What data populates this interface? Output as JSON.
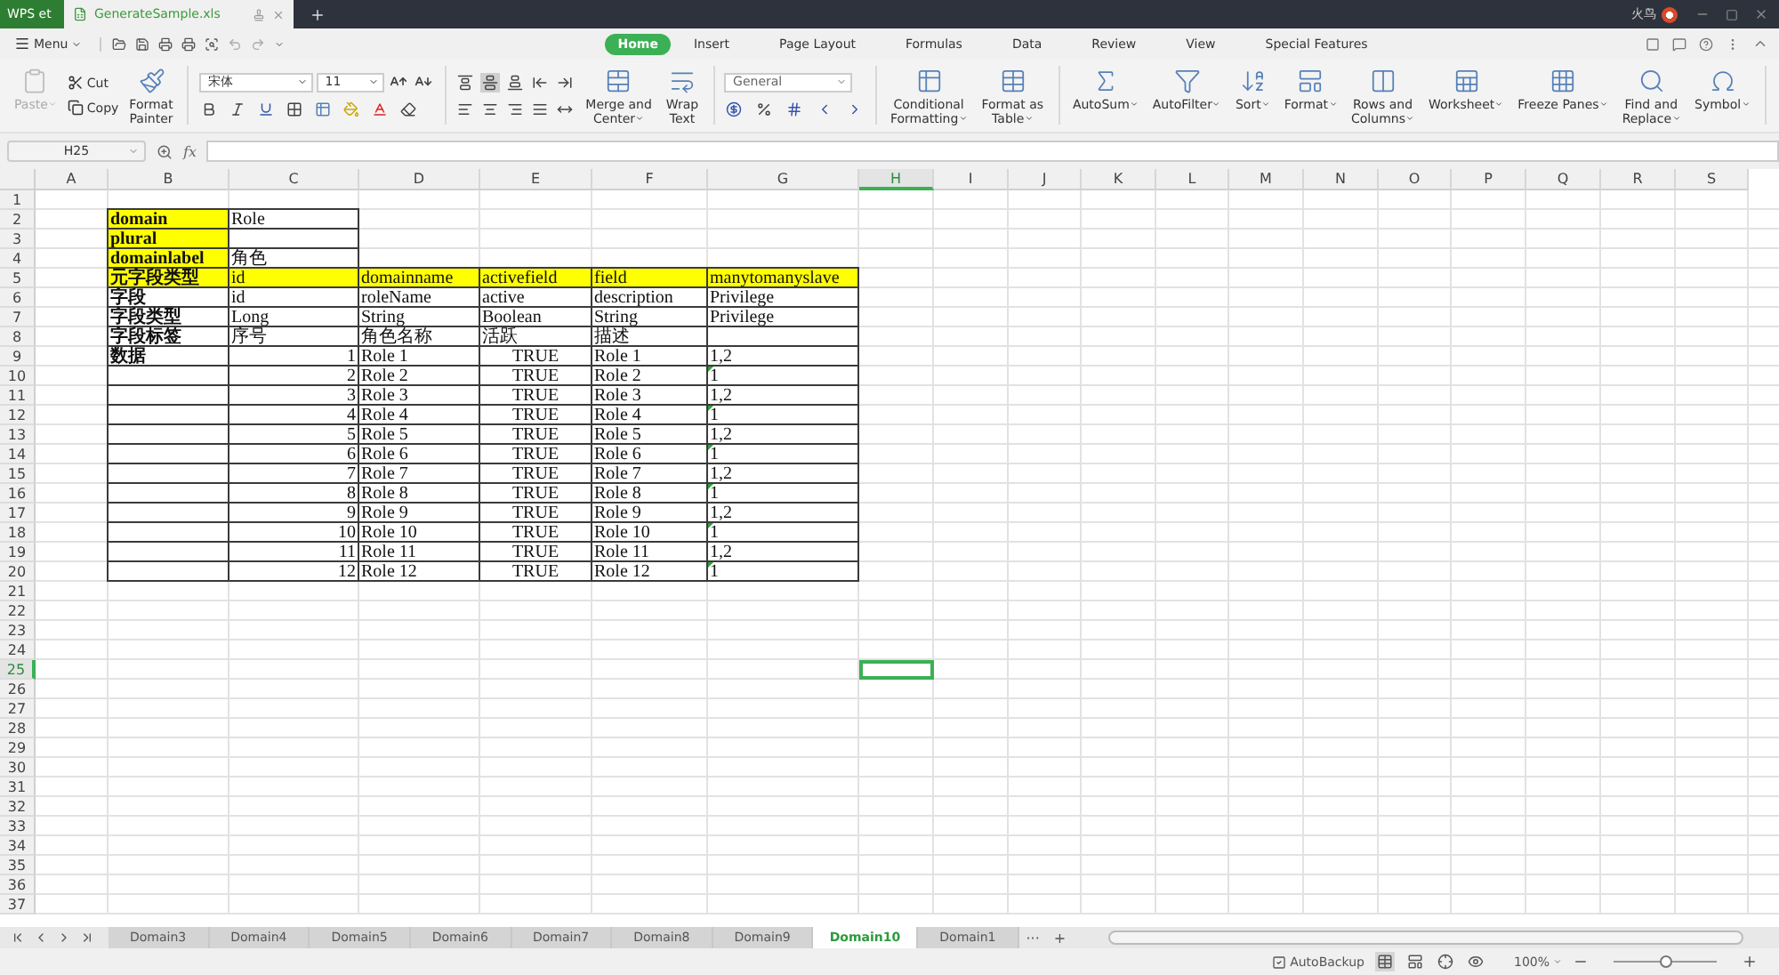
{
  "titlebar": {
    "app_tab": "WPS et",
    "doc_tab": {
      "title": "GenerateSample.xls",
      "selected": true
    },
    "user": "火鸟"
  },
  "menu": {
    "label": "Menu",
    "tabs": [
      {
        "label": "Home",
        "selected": true
      },
      {
        "label": "Insert",
        "selected": false
      },
      {
        "label": "Page Layout",
        "selected": false
      },
      {
        "label": "Formulas",
        "selected": false
      },
      {
        "label": "Data",
        "selected": false
      },
      {
        "label": "Review",
        "selected": false
      },
      {
        "label": "View",
        "selected": false
      },
      {
        "label": "Special Features",
        "selected": false
      }
    ]
  },
  "ribbon": [
    {
      "kind": "big",
      "label": "Paste",
      "dropdown": true,
      "disabled": true
    },
    {
      "kind": "stack",
      "items": [
        "Cut",
        "Copy"
      ]
    },
    {
      "kind": "big",
      "label": "Format\nPainter",
      "dropdown": false,
      "disabled": false
    },
    {
      "kind": "separator"
    },
    {
      "kind": "font",
      "font": "宋体",
      "size": "11"
    },
    {
      "kind": "separator"
    },
    {
      "kind": "align",
      "buttons": [
        {
          "selected": false
        },
        {
          "selected": true
        },
        {
          "selected": false
        },
        {
          "selected": false
        },
        {
          "selected": false
        },
        {
          "selected": false
        },
        {
          "selected": false
        },
        {
          "selected": false
        },
        {
          "selected": false
        },
        {
          "selected": false
        }
      ]
    },
    {
      "kind": "big",
      "label": "Merge and\nCenter",
      "dropdown": true,
      "disabled": false
    },
    {
      "kind": "big",
      "label": "Wrap\nText",
      "dropdown": false,
      "disabled": false
    },
    {
      "kind": "separator"
    },
    {
      "kind": "number",
      "format": "General"
    },
    {
      "kind": "separator"
    },
    {
      "kind": "big",
      "label": "Conditional\nFormatting",
      "dropdown": true,
      "disabled": false
    },
    {
      "kind": "big",
      "label": "Format as\nTable",
      "dropdown": true,
      "disabled": false
    },
    {
      "kind": "separator"
    },
    {
      "kind": "big",
      "label": "AutoSum",
      "dropdown": true,
      "disabled": false
    },
    {
      "kind": "big",
      "label": "AutoFilter",
      "dropdown": true,
      "disabled": false
    },
    {
      "kind": "big",
      "label": "Sort",
      "dropdown": true,
      "disabled": false
    },
    {
      "kind": "big",
      "label": "Format",
      "dropdown": true,
      "disabled": false
    },
    {
      "kind": "big",
      "label": "Rows and\nColumns",
      "dropdown": true,
      "disabled": false
    },
    {
      "kind": "big",
      "label": "Worksheet",
      "dropdown": true,
      "disabled": false
    },
    {
      "kind": "big",
      "label": "Freeze Panes",
      "dropdown": true,
      "disabled": false
    },
    {
      "kind": "big",
      "label": "Find and\nReplace",
      "dropdown": true,
      "disabled": false
    },
    {
      "kind": "big",
      "label": "Symbol",
      "dropdown": true,
      "disabled": false
    },
    {
      "kind": "separator"
    }
  ],
  "formula_bar": {
    "name_box": "H25",
    "fx": "fx"
  },
  "sheet": {
    "columns": [
      {
        "label": "A",
        "selected": false
      },
      {
        "label": "B",
        "selected": false
      },
      {
        "label": "C",
        "selected": false
      },
      {
        "label": "D",
        "selected": false
      },
      {
        "label": "E",
        "selected": false
      },
      {
        "label": "F",
        "selected": false
      },
      {
        "label": "G",
        "selected": false
      },
      {
        "label": "H",
        "selected": true
      },
      {
        "label": "I",
        "selected": false
      },
      {
        "label": "J",
        "selected": false
      },
      {
        "label": "K",
        "selected": false
      },
      {
        "label": "L",
        "selected": false
      },
      {
        "label": "M",
        "selected": false
      },
      {
        "label": "N",
        "selected": false
      },
      {
        "label": "O",
        "selected": false
      },
      {
        "label": "P",
        "selected": false
      },
      {
        "label": "Q",
        "selected": false
      },
      {
        "label": "R",
        "selected": false
      },
      {
        "label": "S",
        "selected": false
      }
    ],
    "rows": [
      {
        "number": "1",
        "selected": false
      },
      {
        "number": "2",
        "selected": false,
        "cells": [
          {
            "kind": "empty",
            "flag": false
          },
          {
            "kind": "key",
            "text": "domain",
            "flag": false
          },
          {
            "kind": "text",
            "text": "Role",
            "flag": false
          },
          {
            "kind": "empty",
            "flag": false
          },
          {
            "kind": "empty",
            "flag": false
          },
          {
            "kind": "empty",
            "flag": false
          },
          {
            "kind": "empty",
            "flag": false
          }
        ]
      },
      {
        "number": "3",
        "selected": false,
        "cells": [
          {
            "kind": "empty",
            "flag": false
          },
          {
            "kind": "key",
            "text": "plural",
            "flag": false
          },
          {
            "kind": "blank",
            "flag": false
          },
          {
            "kind": "empty",
            "flag": false
          },
          {
            "kind": "empty",
            "flag": false
          },
          {
            "kind": "empty",
            "flag": false
          },
          {
            "kind": "empty",
            "flag": false
          }
        ]
      },
      {
        "number": "4",
        "selected": false,
        "cells": [
          {
            "kind": "empty",
            "flag": false
          },
          {
            "kind": "key",
            "text": "domainlabel",
            "flag": false
          },
          {
            "kind": "text",
            "text": "角色",
            "flag": false
          },
          {
            "kind": "empty",
            "flag": false
          },
          {
            "kind": "empty",
            "flag": false
          },
          {
            "kind": "empty",
            "flag": false
          },
          {
            "kind": "empty",
            "flag": false
          }
        ]
      },
      {
        "number": "5",
        "selected": false,
        "cells": [
          {
            "kind": "empty",
            "flag": false
          },
          {
            "kind": "key",
            "text": "元字段类型",
            "flag": false
          },
          {
            "kind": "head",
            "text": "id",
            "flag": false
          },
          {
            "kind": "head",
            "text": "domainname",
            "flag": false
          },
          {
            "kind": "head",
            "text": "activefield",
            "flag": false
          },
          {
            "kind": "head",
            "text": "field",
            "flag": false
          },
          {
            "kind": "head",
            "text": "manytomanyslave",
            "flag": false
          }
        ]
      },
      {
        "number": "6",
        "selected": false,
        "cells": [
          {
            "kind": "empty",
            "flag": false
          },
          {
            "kind": "label",
            "text": "字段",
            "flag": false
          },
          {
            "kind": "text",
            "text": "id",
            "flag": false
          },
          {
            "kind": "text",
            "text": "roleName",
            "flag": false
          },
          {
            "kind": "text",
            "text": "active",
            "flag": false
          },
          {
            "kind": "text",
            "text": "description",
            "flag": false
          },
          {
            "kind": "text",
            "text": "Privilege",
            "flag": false
          }
        ]
      },
      {
        "number": "7",
        "selected": false,
        "cells": [
          {
            "kind": "empty",
            "flag": false
          },
          {
            "kind": "label",
            "text": "字段类型",
            "flag": false
          },
          {
            "kind": "text",
            "text": "Long",
            "flag": false
          },
          {
            "kind": "text",
            "text": "String",
            "flag": false
          },
          {
            "kind": "text",
            "text": "Boolean",
            "flag": false
          },
          {
            "kind": "text",
            "text": "String",
            "flag": false
          },
          {
            "kind": "text",
            "text": "Privilege",
            "flag": false
          }
        ]
      },
      {
        "number": "8",
        "selected": false,
        "cells": [
          {
            "kind": "empty",
            "flag": false
          },
          {
            "kind": "label",
            "text": "字段标签",
            "flag": false
          },
          {
            "kind": "text",
            "text": "序号",
            "flag": false
          },
          {
            "kind": "text",
            "text": "角色名称",
            "flag": false
          },
          {
            "kind": "text",
            "text": "活跃",
            "flag": false
          },
          {
            "kind": "text",
            "text": "描述",
            "flag": false
          },
          {
            "kind": "blank",
            "flag": false
          }
        ]
      },
      {
        "number": "9",
        "selected": false,
        "cells": [
          {
            "kind": "empty",
            "flag": false
          },
          {
            "kind": "label",
            "text": "数据",
            "flag": false
          },
          {
            "kind": "num",
            "text": "1",
            "flag": false
          },
          {
            "kind": "text",
            "text": "Role 1",
            "flag": false
          },
          {
            "kind": "bool",
            "text": "TRUE",
            "flag": false
          },
          {
            "kind": "text",
            "text": "Role 1",
            "flag": false
          },
          {
            "kind": "text",
            "text": "1,2",
            "flag": false
          }
        ]
      },
      {
        "number": "10",
        "selected": false,
        "cells": [
          {
            "kind": "empty",
            "flag": false
          },
          {
            "kind": "blank",
            "flag": false
          },
          {
            "kind": "num",
            "text": "2",
            "flag": false
          },
          {
            "kind": "text",
            "text": "Role 2",
            "flag": false
          },
          {
            "kind": "bool",
            "text": "TRUE",
            "flag": false
          },
          {
            "kind": "text",
            "text": "Role 2",
            "flag": false
          },
          {
            "kind": "text",
            "text": "1",
            "flag": true
          }
        ]
      },
      {
        "number": "11",
        "selected": false,
        "cells": [
          {
            "kind": "empty",
            "flag": false
          },
          {
            "kind": "blank",
            "flag": false
          },
          {
            "kind": "num",
            "text": "3",
            "flag": false
          },
          {
            "kind": "text",
            "text": "Role 3",
            "flag": false
          },
          {
            "kind": "bool",
            "text": "TRUE",
            "flag": false
          },
          {
            "kind": "text",
            "text": "Role 3",
            "flag": false
          },
          {
            "kind": "text",
            "text": "1,2",
            "flag": false
          }
        ]
      },
      {
        "number": "12",
        "selected": false,
        "cells": [
          {
            "kind": "empty",
            "flag": false
          },
          {
            "kind": "blank",
            "flag": false
          },
          {
            "kind": "num",
            "text": "4",
            "flag": false
          },
          {
            "kind": "text",
            "text": "Role 4",
            "flag": false
          },
          {
            "kind": "bool",
            "text": "TRUE",
            "flag": false
          },
          {
            "kind": "text",
            "text": "Role 4",
            "flag": false
          },
          {
            "kind": "text",
            "text": "1",
            "flag": true
          }
        ]
      },
      {
        "number": "13",
        "selected": false,
        "cells": [
          {
            "kind": "empty",
            "flag": false
          },
          {
            "kind": "blank",
            "flag": false
          },
          {
            "kind": "num",
            "text": "5",
            "flag": false
          },
          {
            "kind": "text",
            "text": "Role 5",
            "flag": false
          },
          {
            "kind": "bool",
            "text": "TRUE",
            "flag": false
          },
          {
            "kind": "text",
            "text": "Role 5",
            "flag": false
          },
          {
            "kind": "text",
            "text": "1,2",
            "flag": false
          }
        ]
      },
      {
        "number": "14",
        "selected": false,
        "cells": [
          {
            "kind": "empty",
            "flag": false
          },
          {
            "kind": "blank",
            "flag": false
          },
          {
            "kind": "num",
            "text": "6",
            "flag": false
          },
          {
            "kind": "text",
            "text": "Role 6",
            "flag": false
          },
          {
            "kind": "bool",
            "text": "TRUE",
            "flag": false
          },
          {
            "kind": "text",
            "text": "Role 6",
            "flag": false
          },
          {
            "kind": "text",
            "text": "1",
            "flag": true
          }
        ]
      },
      {
        "number": "15",
        "selected": false,
        "cells": [
          {
            "kind": "empty",
            "flag": false
          },
          {
            "kind": "blank",
            "flag": false
          },
          {
            "kind": "num",
            "text": "7",
            "flag": false
          },
          {
            "kind": "text",
            "text": "Role 7",
            "flag": false
          },
          {
            "kind": "bool",
            "text": "TRUE",
            "flag": false
          },
          {
            "kind": "text",
            "text": "Role 7",
            "flag": false
          },
          {
            "kind": "text",
            "text": "1,2",
            "flag": false
          }
        ]
      },
      {
        "number": "16",
        "selected": false,
        "cells": [
          {
            "kind": "empty",
            "flag": false
          },
          {
            "kind": "blank",
            "flag": false
          },
          {
            "kind": "num",
            "text": "8",
            "flag": false
          },
          {
            "kind": "text",
            "text": "Role 8",
            "flag": false
          },
          {
            "kind": "bool",
            "text": "TRUE",
            "flag": false
          },
          {
            "kind": "text",
            "text": "Role 8",
            "flag": false
          },
          {
            "kind": "text",
            "text": "1",
            "flag": true
          }
        ]
      },
      {
        "number": "17",
        "selected": false,
        "cells": [
          {
            "kind": "empty",
            "flag": false
          },
          {
            "kind": "blank",
            "flag": false
          },
          {
            "kind": "num",
            "text": "9",
            "flag": false
          },
          {
            "kind": "text",
            "text": "Role 9",
            "flag": false
          },
          {
            "kind": "bool",
            "text": "TRUE",
            "flag": false
          },
          {
            "kind": "text",
            "text": "Role 9",
            "flag": false
          },
          {
            "kind": "text",
            "text": "1,2",
            "flag": false
          }
        ]
      },
      {
        "number": "18",
        "selected": false,
        "cells": [
          {
            "kind": "empty",
            "flag": false
          },
          {
            "kind": "blank",
            "flag": false
          },
          {
            "kind": "num",
            "text": "10",
            "flag": false
          },
          {
            "kind": "text",
            "text": "Role 10",
            "flag": false
          },
          {
            "kind": "bool",
            "text": "TRUE",
            "flag": false
          },
          {
            "kind": "text",
            "text": "Role 10",
            "flag": false
          },
          {
            "kind": "text",
            "text": "1",
            "flag": true
          }
        ]
      },
      {
        "number": "19",
        "selected": false,
        "cells": [
          {
            "kind": "empty",
            "flag": false
          },
          {
            "kind": "blank",
            "flag": false
          },
          {
            "kind": "num",
            "text": "11",
            "flag": false
          },
          {
            "kind": "text",
            "text": "Role 11",
            "flag": false
          },
          {
            "kind": "bool",
            "text": "TRUE",
            "flag": false
          },
          {
            "kind": "text",
            "text": "Role 11",
            "flag": false
          },
          {
            "kind": "text",
            "text": "1,2",
            "flag": false
          }
        ]
      },
      {
        "number": "20",
        "selected": false,
        "cells": [
          {
            "kind": "empty",
            "flag": false
          },
          {
            "kind": "blank",
            "flag": false
          },
          {
            "kind": "num",
            "text": "12",
            "flag": false
          },
          {
            "kind": "text",
            "text": "Role 12",
            "flag": false
          },
          {
            "kind": "bool",
            "text": "TRUE",
            "flag": false
          },
          {
            "kind": "text",
            "text": "Role 12",
            "flag": false
          },
          {
            "kind": "text",
            "text": "1",
            "flag": true
          }
        ]
      },
      {
        "number": "21",
        "selected": false
      },
      {
        "number": "22",
        "selected": false
      },
      {
        "number": "23",
        "selected": false
      },
      {
        "number": "24",
        "selected": false
      },
      {
        "number": "25",
        "selected": true
      },
      {
        "number": "26",
        "selected": false
      },
      {
        "number": "27",
        "selected": false
      },
      {
        "number": "28",
        "selected": false
      },
      {
        "number": "29",
        "selected": false
      },
      {
        "number": "30",
        "selected": false
      },
      {
        "number": "31",
        "selected": false
      },
      {
        "number": "32",
        "selected": false
      },
      {
        "number": "33",
        "selected": false
      },
      {
        "number": "34",
        "selected": false
      },
      {
        "number": "35",
        "selected": false
      },
      {
        "number": "36",
        "selected": false
      },
      {
        "number": "37",
        "selected": false
      }
    ]
  },
  "sheet_tabs": {
    "tabs": [
      {
        "label": "Domain3",
        "selected": false
      },
      {
        "label": "Domain4",
        "selected": false
      },
      {
        "label": "Domain5",
        "selected": false
      },
      {
        "label": "Domain6",
        "selected": false
      },
      {
        "label": "Domain7",
        "selected": false
      },
      {
        "label": "Domain8",
        "selected": false
      },
      {
        "label": "Domain9",
        "selected": false
      },
      {
        "label": "Domain10",
        "selected": true
      },
      {
        "label": "Domain1",
        "selected": false
      }
    ],
    "more": "···",
    "add": "+"
  },
  "status_bar": {
    "backup": "AutoBackup",
    "zoom": "100%",
    "zoom_slider": {
      "level": 0.5
    }
  }
}
